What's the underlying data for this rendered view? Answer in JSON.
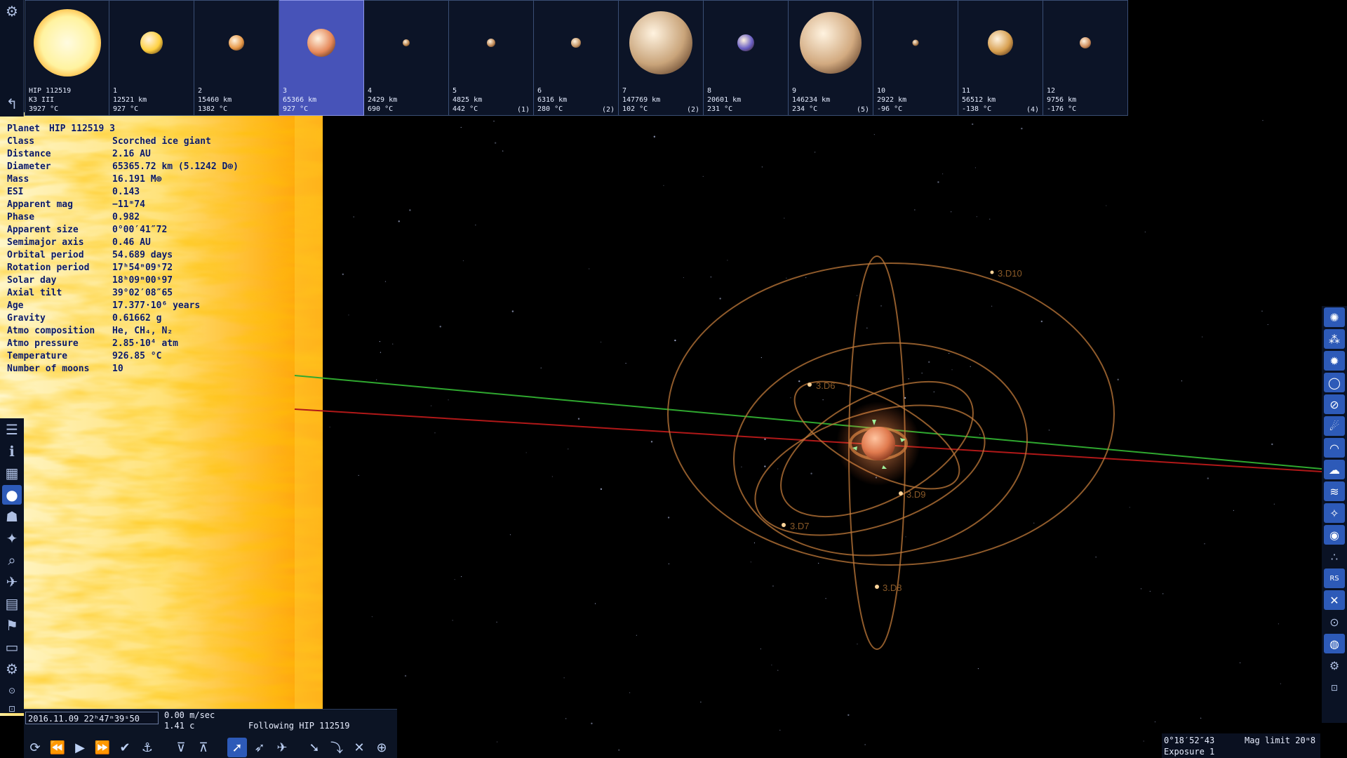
{
  "planets": [
    {
      "num": "HIP 112519",
      "line2": "K3 III",
      "temp": "3927 °C",
      "moons": "",
      "color": "#fff3a0",
      "size": 96,
      "selected": false,
      "star": true
    },
    {
      "num": "1",
      "line2": "12521 km",
      "temp": "927 °C",
      "moons": "",
      "color": "#ffd040",
      "size": 32,
      "selected": false,
      "star": false
    },
    {
      "num": "2",
      "line2": "15460 km",
      "temp": "1382 °C",
      "moons": "",
      "color": "#e89a4a",
      "size": 22,
      "selected": false,
      "star": false
    },
    {
      "num": "3",
      "line2": "65366 km",
      "temp": "927 °C",
      "moons": "",
      "color": "#e6895a",
      "size": 40,
      "selected": true,
      "star": false
    },
    {
      "num": "4",
      "line2": "2429 km",
      "temp": "690 °C",
      "moons": "",
      "color": "#b8824a",
      "size": 10,
      "selected": false,
      "star": false
    },
    {
      "num": "5",
      "line2": "4825 km",
      "temp": "442 °C",
      "moons": "(1)",
      "color": "#c08a58",
      "size": 12,
      "selected": false,
      "star": false
    },
    {
      "num": "6",
      "line2": "6316 km",
      "temp": "280 °C",
      "moons": "(2)",
      "color": "#c89a6a",
      "size": 14,
      "selected": false,
      "star": false
    },
    {
      "num": "7",
      "line2": "147769 km",
      "temp": "102 °C",
      "moons": "(2)",
      "color": "#c9a47a",
      "size": 90,
      "selected": false,
      "star": false
    },
    {
      "num": "8",
      "line2": "20601 km",
      "temp": "231 °C",
      "moons": "",
      "color": "#6a5fc4",
      "size": 24,
      "selected": false,
      "star": false
    },
    {
      "num": "9",
      "line2": "146234 km",
      "temp": "234 °C",
      "moons": "(5)",
      "color": "#d2aa80",
      "size": 88,
      "selected": false,
      "star": false
    },
    {
      "num": "10",
      "line2": "2922 km",
      "temp": "-96 °C",
      "moons": "",
      "color": "#b08050",
      "size": 9,
      "selected": false,
      "star": false
    },
    {
      "num": "11",
      "line2": "56512 km",
      "temp": "-138 °C",
      "moons": "(4)",
      "color": "#d8a050",
      "size": 36,
      "selected": false,
      "star": false
    },
    {
      "num": "12",
      "line2": "9756 km",
      "temp": "-176 °C",
      "moons": "",
      "color": "#d09060",
      "size": 16,
      "selected": false,
      "star": false
    }
  ],
  "info": {
    "title_key": "Planet",
    "title_value": "HIP 112519 3",
    "rows": [
      {
        "k": "Class",
        "v": "Scorched ice giant"
      },
      {
        "k": "Distance",
        "v": "2.16 AU"
      },
      {
        "k": "Diameter",
        "v": "65365.72 km (5.1242 D⊕)"
      },
      {
        "k": "Mass",
        "v": "16.191 M⊕"
      },
      {
        "k": "ESI",
        "v": "0.143"
      },
      {
        "k": "Apparent mag",
        "v": "−11ᵐ74"
      },
      {
        "k": "Phase",
        "v": "0.982"
      },
      {
        "k": "Apparent size",
        "v": "0°00′41″72"
      },
      {
        "k": "Semimajor axis",
        "v": "0.46 AU"
      },
      {
        "k": "Orbital period",
        "v": "54.689 days"
      },
      {
        "k": "Rotation period",
        "v": "17ʰ54ᵐ09ˢ72"
      },
      {
        "k": "Solar day",
        "v": "18ʰ09ᵐ00ˢ97"
      },
      {
        "k": "Axial tilt",
        "v": "39°02′08″65"
      },
      {
        "k": "Age",
        "v": "17.377·10⁶ years"
      },
      {
        "k": "Gravity",
        "v": "0.61662 g"
      },
      {
        "k": "Atmo composition",
        "v": "He, CH₄, N₂"
      },
      {
        "k": "Atmo pressure",
        "v": "2.85·10⁴ atm"
      },
      {
        "k": "Temperature",
        "v": "926.85 °C"
      },
      {
        "k": "Number of moons",
        "v": "10"
      }
    ]
  },
  "moon_labels": {
    "d10": "3.D10",
    "d6": "3.D6",
    "d9": "3.D9",
    "d7": "3.D7",
    "d8": "3.D8"
  },
  "time": {
    "date": "2016.11.09  22ʰ47ᵐ39ˢ50",
    "speed": "0.00  m/sec",
    "speed_c": "1.41  c",
    "following": "Following  HIP 112519"
  },
  "status": {
    "fov": "0°18′52″43",
    "mag_limit": "Mag limit  20ᵐ8",
    "exposure": "Exposure 1"
  },
  "colors": {
    "accent": "#2d5ab8",
    "selected_tile": "#4753b8",
    "orbit": "#c07a3a",
    "green_line": "#2fa82f",
    "red_line": "#b01818"
  }
}
